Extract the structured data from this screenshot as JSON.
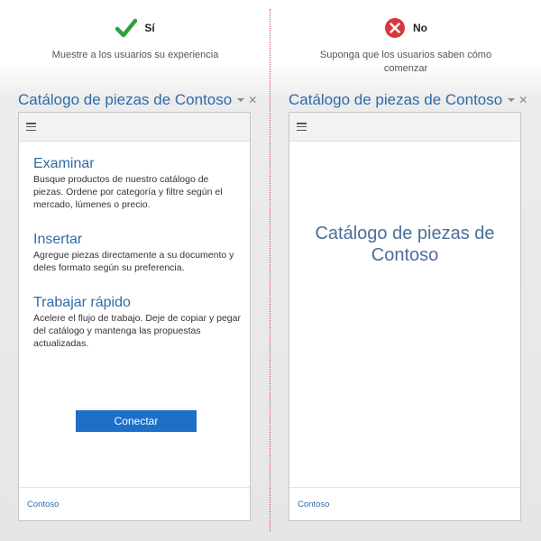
{
  "left": {
    "verdict_label": "Sí",
    "verdict_desc": "Muestre a los usuarios su experiencia",
    "pane_title": "Catálogo de piezas de Contoso",
    "features": [
      {
        "title": "Examinar",
        "desc": "Busque productos de nuestro catálogo de piezas. Ordene por categoría y filtre según el mercado, lúmenes o precio."
      },
      {
        "title": "Insertar",
        "desc": "Agregue piezas directamente a su documento y deles formato según su preferencia."
      },
      {
        "title": "Trabajar rápido",
        "desc": "Acelere el flujo de trabajo. Deje de copiar y pegar del catálogo y mantenga las propuestas actualizadas."
      }
    ],
    "connect_label": "Conectar",
    "footer_link": "Contoso"
  },
  "right": {
    "verdict_label": "No",
    "verdict_desc": "Suponga que los usuarios saben cómo comenzar",
    "pane_title": "Catálogo de piezas de Contoso",
    "center_title": "Catálogo de piezas de Contoso",
    "footer_link": "Contoso"
  },
  "colors": {
    "yes_green": "#2ea13b",
    "no_red": "#d9363e",
    "accent_blue": "#2f6ba8",
    "button_blue": "#1e6fc8"
  },
  "icons": {
    "yes": "checkmark-icon",
    "no": "x-circle-icon",
    "menu": "hamburger-icon",
    "close": "close-icon",
    "dropdown": "caret-down-icon"
  }
}
